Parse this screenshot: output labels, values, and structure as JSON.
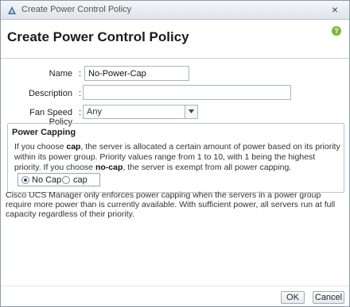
{
  "window": {
    "title": "Create Power Control Policy",
    "close_glyph": "×"
  },
  "header": {
    "title": "Create Power Control Policy",
    "help_glyph": "?"
  },
  "form": {
    "name": {
      "label": "Name",
      "value": "No-Power-Cap"
    },
    "description": {
      "label": "Description",
      "value": ""
    },
    "fan_speed": {
      "label": "Fan Speed Policy",
      "value": "Any"
    }
  },
  "power_capping": {
    "legend": "Power Capping",
    "text_parts": {
      "p1": "If you choose ",
      "cap": "cap",
      "p2": ", the server is allocated a certain amount of power based on its priority within its power group. Priority values range from 1 to 10, with 1 being the highest priority. If you choose ",
      "nocap": "no-cap",
      "p3": ", the server is exempt from all power capping."
    },
    "options": [
      {
        "label": "No Cap",
        "checked": true
      },
      {
        "label": "cap",
        "checked": false
      }
    ]
  },
  "note": "Cisco UCS Manager only enforces power capping when the servers in a power group require more power than is currently available. With sufficient power, all servers run at full capacity regardless of their priority.",
  "buttons": {
    "ok": "OK",
    "cancel": "Cancel"
  },
  "colors": {
    "accent": "#2b4f7a",
    "help_green": "#7ab83a",
    "app_icon": "#3f6f9e"
  },
  "icons": {
    "app": "cisco-triangle-icon",
    "close": "close-icon",
    "help": "help-icon",
    "dropdown": "chevron-down-icon"
  }
}
